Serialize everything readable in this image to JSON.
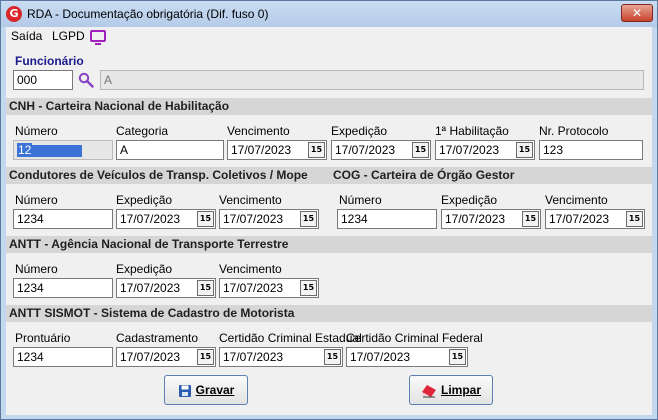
{
  "window": {
    "title": "RDA - Documentação obrigatória (Dif. fuso 0)",
    "close": "✕"
  },
  "app_icon": "G",
  "menu": {
    "saida": "Saída",
    "lgpd": "LGPD"
  },
  "funcionario": {
    "label": "Funcionário",
    "code": "000",
    "name": "A"
  },
  "cnh": {
    "section": "CNH - Carteira Nacional de Habilitação",
    "numero_label": "Número",
    "numero_value": "12",
    "categoria_label": "Categoria",
    "categoria_value": "A",
    "vencimento_label": "Vencimento",
    "vencimento_value": "17/07/2023",
    "expedicao_label": "Expedição",
    "expedicao_value": "17/07/2023",
    "primeira_label": "1ª Habilitação",
    "primeira_value": "17/07/2023",
    "protocolo_label": "Nr. Protocolo",
    "protocolo_value": "123"
  },
  "condutores": {
    "section": "Condutores de Veículos de Transp. Coletivos / Mope",
    "numero_label": "Número",
    "numero_value": "1234",
    "expedicao_label": "Expedição",
    "expedicao_value": "17/07/2023",
    "vencimento_label": "Vencimento",
    "vencimento_value": "17/07/2023"
  },
  "cog": {
    "section": "COG - Carteira de Órgão Gestor",
    "numero_label": "Número",
    "numero_value": "1234",
    "expedicao_label": "Expedição",
    "expedicao_value": "17/07/2023",
    "vencimento_label": "Vencimento",
    "vencimento_value": "17/07/2023"
  },
  "antt": {
    "section": "ANTT - Agência Nacional de Transporte Terrestre",
    "numero_label": "Número",
    "numero_value": "1234",
    "expedicao_label": "Expedição",
    "expedicao_value": "17/07/2023",
    "vencimento_label": "Vencimento",
    "vencimento_value": "17/07/2023"
  },
  "sismot": {
    "section": "ANTT SISMOT - Sistema de Cadastro de Motorista",
    "prontuario_label": "Prontuário",
    "prontuario_value": "1234",
    "cadastramento_label": "Cadastramento",
    "cadastramento_value": "17/07/2023",
    "estadual_label": "Certidão Criminal Estadual",
    "estadual_value": "17/07/2023",
    "federal_label": "Certidão Criminal Federal",
    "federal_value": "17/07/2023"
  },
  "calendar_glyph": "15",
  "buttons": {
    "gravar": "Gravar",
    "limpar": "Limpar"
  }
}
